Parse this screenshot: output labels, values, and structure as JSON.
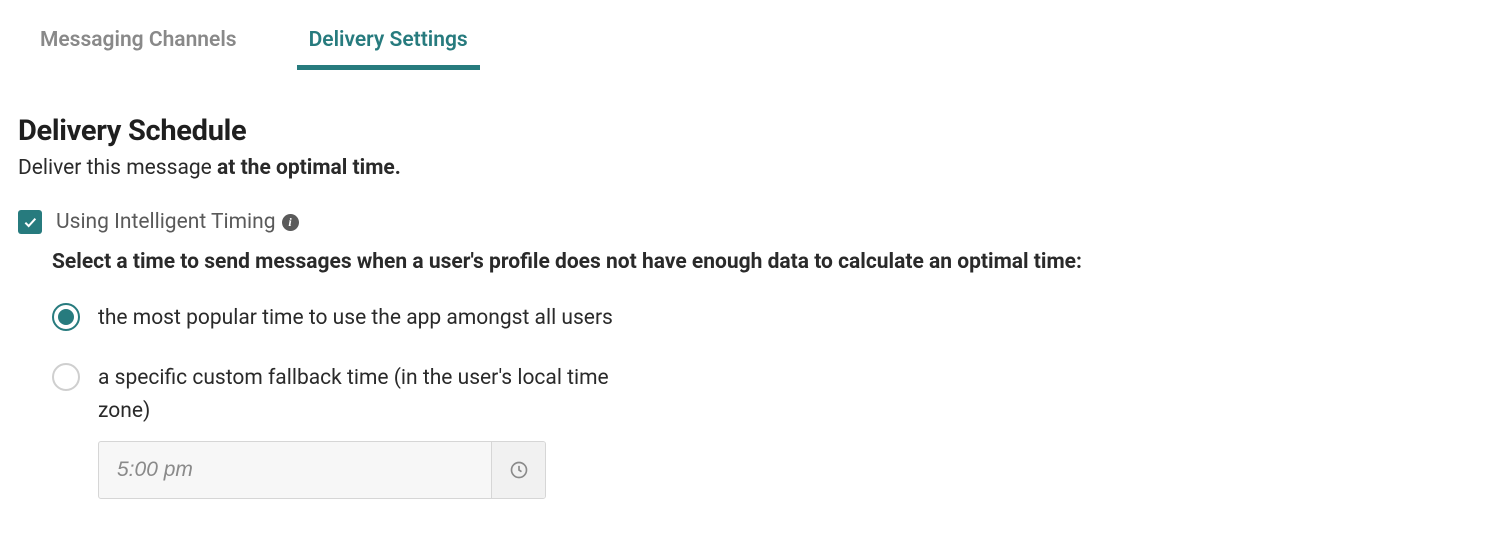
{
  "tabs": {
    "messaging_channels": "Messaging Channels",
    "delivery_settings": "Delivery Settings"
  },
  "section": {
    "title": "Delivery Schedule",
    "subtitle_prefix": "Deliver this message ",
    "subtitle_bold": "at the optimal time."
  },
  "intelligent_timing": {
    "label": "Using Intelligent Timing"
  },
  "fallback": {
    "prompt": "Select a time to send messages when a user's profile does not have enough data to calculate an optimal time:",
    "option_popular": "the most popular time to use the app amongst all users",
    "option_custom": "a specific custom fallback time (in the user's local time zone)",
    "time_placeholder": "5:00 pm"
  }
}
